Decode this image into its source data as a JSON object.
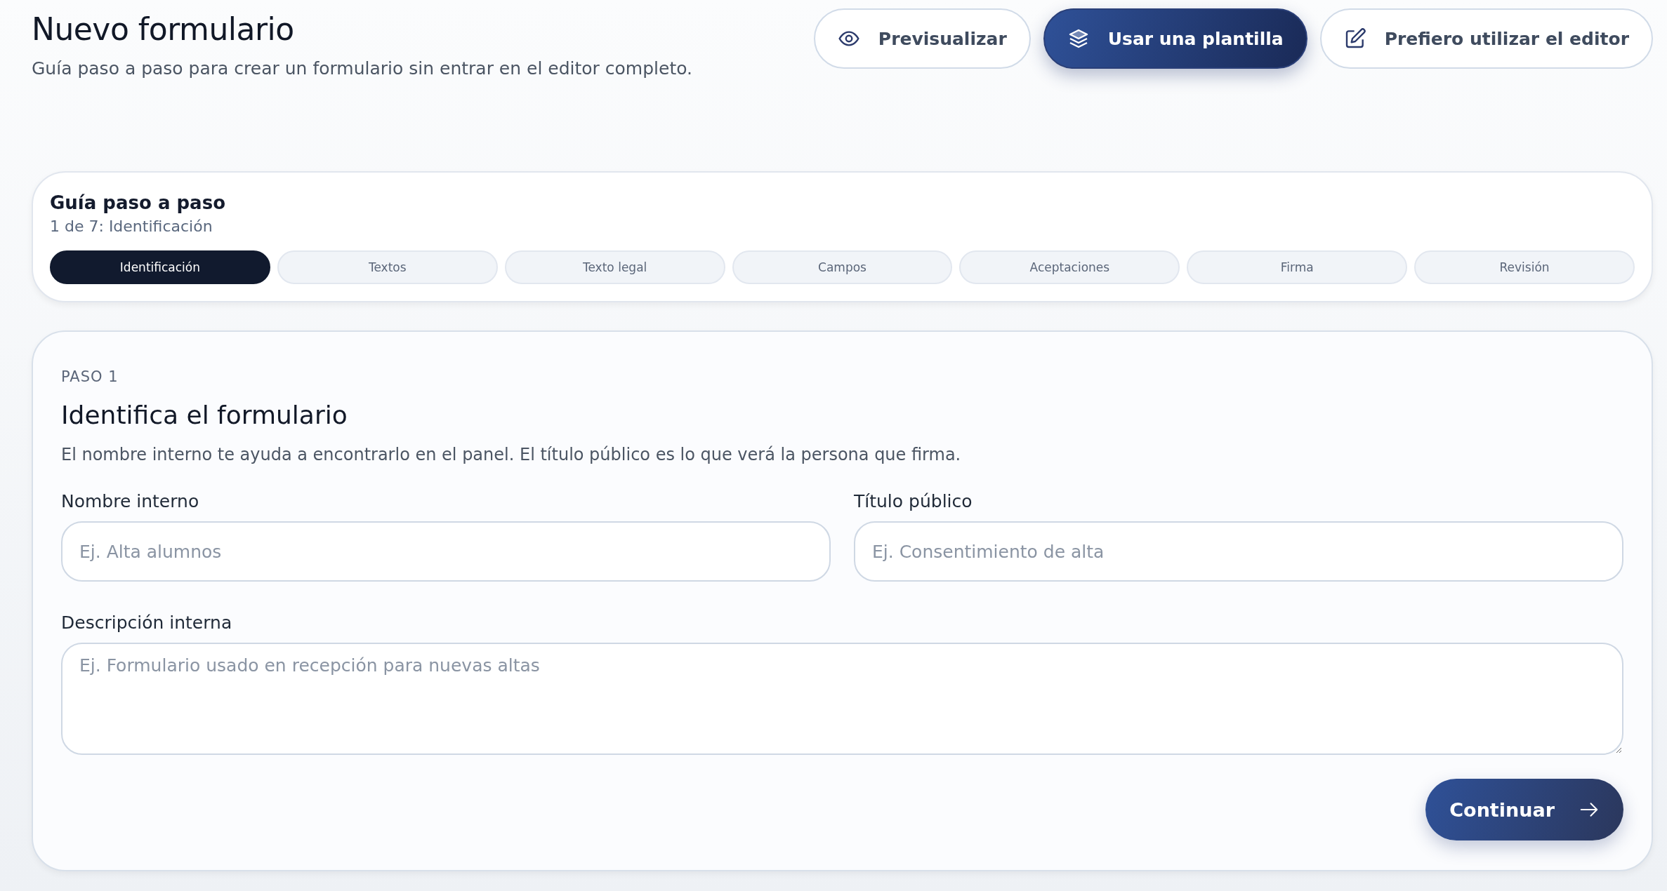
{
  "header": {
    "title": "Nuevo formulario",
    "subtitle": "Guía paso a paso para crear un formulario sin entrar en el editor completo."
  },
  "actions": [
    {
      "label": "Previsualizar",
      "kind": "preview",
      "primary": false
    },
    {
      "label": "Usar una plantilla",
      "kind": "template",
      "primary": true
    },
    {
      "label": "Prefiero utilizar el editor",
      "kind": "editor",
      "primary": false
    }
  ],
  "guide": {
    "title": "Guía paso a paso",
    "progress": "1 de 7: Identificación",
    "steps": [
      {
        "label": "Identificación",
        "selected": true
      },
      {
        "label": "Textos",
        "selected": false
      },
      {
        "label": "Texto legal",
        "selected": false
      },
      {
        "label": "Campos",
        "selected": false
      },
      {
        "label": "Aceptaciones",
        "selected": false
      },
      {
        "label": "Firma",
        "selected": false
      },
      {
        "label": "Revisión",
        "selected": false
      }
    ]
  },
  "step": {
    "eyebrow": "PASO 1",
    "title": "Identifica el formulario",
    "description": "El nombre interno te ayuda a encontrarlo en el panel. El título público es lo que verá la persona que firma.",
    "fields": [
      {
        "label": "Nombre interno",
        "placeholder": "Ej. Alta alumnos",
        "kind": "input"
      },
      {
        "label": "Título público",
        "placeholder": "Ej. Consentimiento de alta",
        "kind": "input"
      },
      {
        "label": "Descripción interna",
        "placeholder": "Ej. Formulario usado en recepción para nuevas altas",
        "kind": "textarea"
      }
    ],
    "continue": "Continuar"
  }
}
